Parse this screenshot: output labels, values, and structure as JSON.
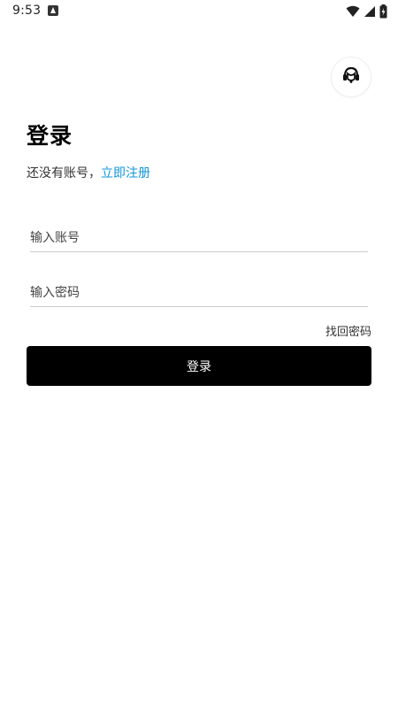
{
  "status_bar": {
    "time": "9:53",
    "icons": [
      "notification-icon",
      "wifi-icon",
      "signal-icon",
      "battery-icon"
    ]
  },
  "support": {
    "icon": "customer-service-icon"
  },
  "page": {
    "title": "登录",
    "register_prompt": "还没有账号，",
    "register_link": "立即注册"
  },
  "form": {
    "account_placeholder": "输入账号",
    "account_value": "",
    "password_placeholder": "输入密码",
    "password_value": "",
    "forgot_label": "找回密码",
    "submit_label": "登录"
  },
  "colors": {
    "link": "#1296db",
    "button_bg": "#000000",
    "button_text": "#ffffff"
  }
}
